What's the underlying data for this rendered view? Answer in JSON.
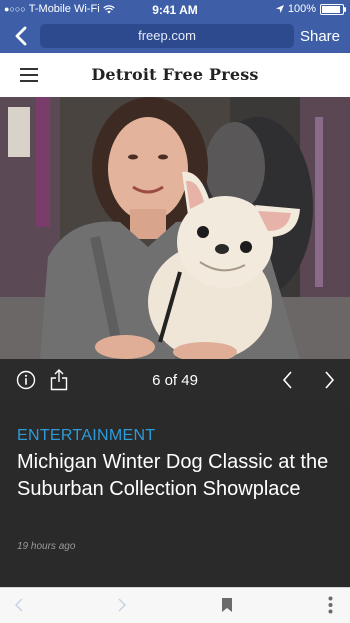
{
  "status_bar": {
    "carrier": "T-Mobile Wi-Fi",
    "time": "9:41 AM",
    "battery": "100%",
    "battery_level": 1.0
  },
  "browser": {
    "url": "freep.com",
    "share_label": "Share"
  },
  "site": {
    "logo_text": "Detroit Free Press"
  },
  "gallery": {
    "counter": "6 of 49"
  },
  "article": {
    "section": "ENTERTAINMENT",
    "headline": "Michigan Winter Dog Classic at the Suburban Collection Showplace",
    "timestamp": "19 hours ago"
  },
  "colors": {
    "browser_bar": "#3e5fa8",
    "section_label": "#2d9bd8",
    "caption_bg": "#2a2a2a"
  }
}
